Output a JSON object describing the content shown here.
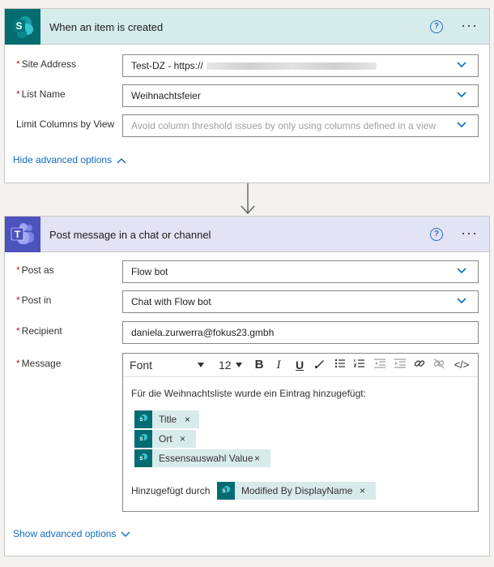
{
  "trigger": {
    "title": "When an item is created",
    "fields": {
      "site_address": {
        "label": "Site Address",
        "value": "Test-DZ - https://"
      },
      "list_name": {
        "label": "List Name",
        "value": "Weihnachtsfeier"
      },
      "limit_columns": {
        "label": "Limit Columns by View",
        "placeholder": "Avoid column threshold issues by only using columns defined in a view"
      }
    },
    "advanced_link": "Hide advanced options"
  },
  "action": {
    "title": "Post message in a chat or channel",
    "fields": {
      "post_as": {
        "label": "Post as",
        "value": "Flow bot"
      },
      "post_in": {
        "label": "Post in",
        "value": "Chat with Flow bot"
      },
      "recipient": {
        "label": "Recipient",
        "value": "daniela.zurwerra@fokus23.gmbh"
      },
      "message": {
        "label": "Message"
      }
    },
    "editor": {
      "font": "Font",
      "font_size": "12",
      "text": "Für die Weihnachtsliste wurde ein Eintrag hinzugefügt:",
      "tokens": [
        "Title",
        "Ort",
        "Essensauswahl Value"
      ],
      "added_by_label": "Hinzugefügt durch",
      "added_by_token": "Modified By DisplayName"
    },
    "advanced_link": "Show advanced options"
  },
  "icons": {
    "sharepoint": "sharepoint-icon",
    "teams": "teams-icon",
    "help": "help-icon",
    "more": "more-options-icon"
  },
  "colors": {
    "sharepoint_teal": "#036c70",
    "teams_purple": "#5059c9",
    "link_blue": "#0f6cbd",
    "required_red": "#a4262c"
  },
  "symbols": {
    "help": "?",
    "more": "···",
    "required": "*",
    "remove": "×",
    "bold": "B",
    "italic": "I",
    "underline": "U",
    "code": "</>",
    "sp_letter": "S",
    "teams_letter": "T"
  }
}
